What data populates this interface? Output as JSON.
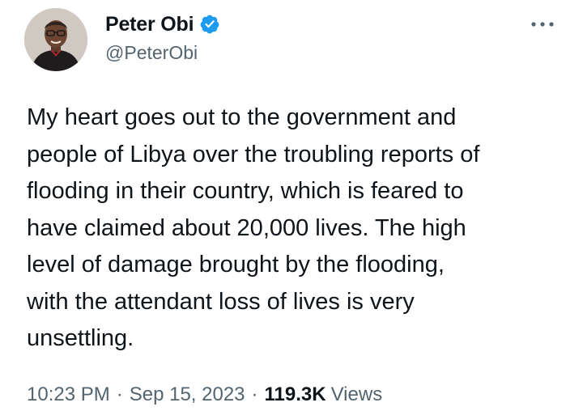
{
  "author": {
    "display_name": "Peter Obi",
    "handle": "@PeterObi",
    "verified": true,
    "verified_color": "#1d9bf0"
  },
  "tweet": {
    "text": "My heart goes out to the government and\npeople of Libya over the troubling reports of\nflooding in their country, which is feared to\nhave claimed about 20,000 lives. The high\nlevel of damage brought by the flooding,\nwith the attendant loss of lives is very\nunsettling.",
    "time": "10:23 PM",
    "date": "Sep 15, 2023",
    "separator": "·",
    "views_count": "119.3K",
    "views_label": "Views"
  },
  "icons": {
    "more": "more-options-icon",
    "verified": "verified-badge-icon"
  }
}
